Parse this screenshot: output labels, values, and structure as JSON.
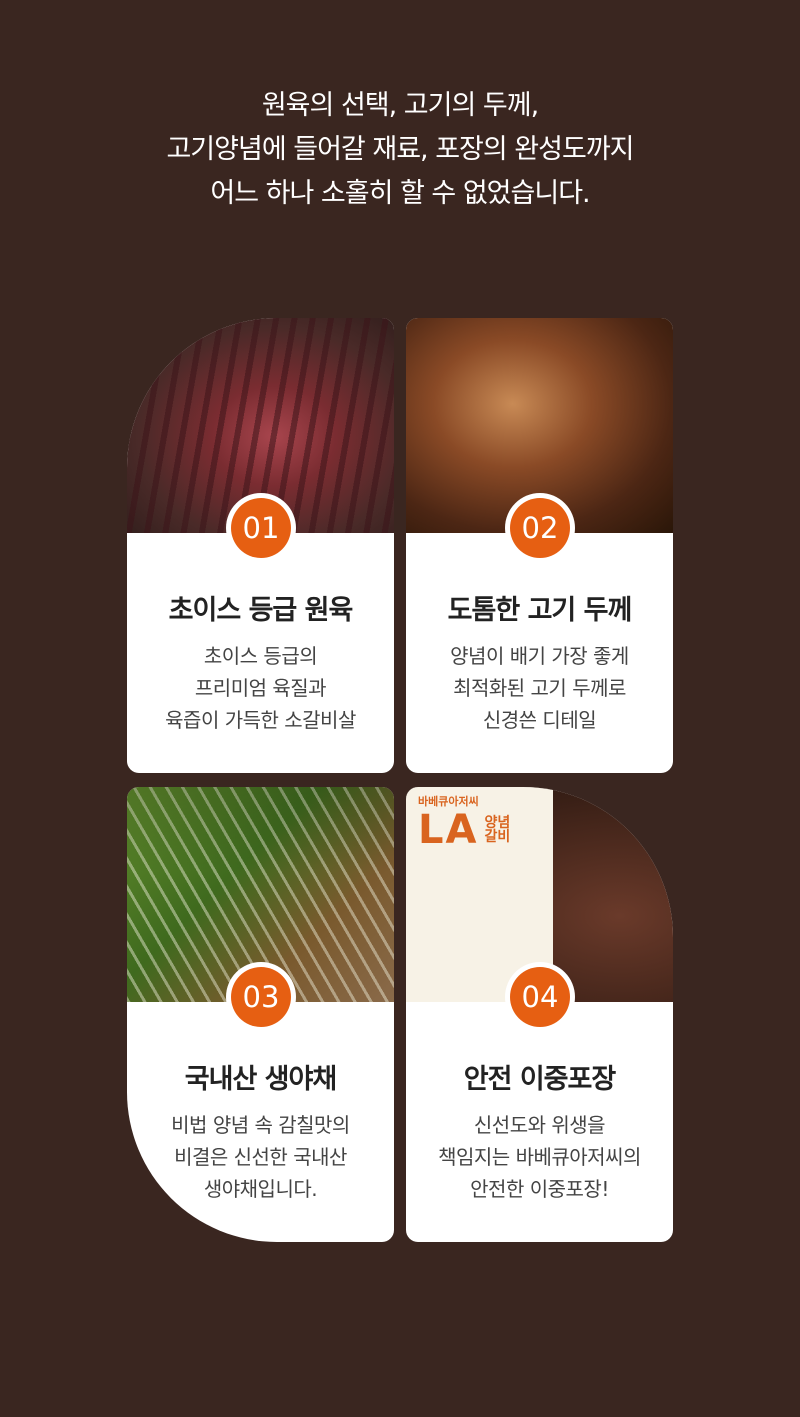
{
  "intro": {
    "lines": [
      "원육의 선택, 고기의 두께,",
      "고기양념에 들어갈 재료, 포장의 완성도까지",
      "어느 하나 소홀히 할 수 없었습니다."
    ]
  },
  "cards": [
    {
      "number": "01",
      "title": "초이스 등급 원육",
      "desc": [
        "초이스 등급의",
        "프리미엄 육질과",
        "육즙이 가득한 소갈비살"
      ]
    },
    {
      "number": "02",
      "title": "도톰한 고기 두께",
      "desc": [
        "양념이 배기 가장 좋게",
        "최적화된 고기 두께로",
        "신경쓴 디테일"
      ]
    },
    {
      "number": "03",
      "title": "국내산 생야채",
      "desc": [
        "비법 양념 속 감칠맛의",
        "비결은 신선한 국내산",
        "생야채입니다."
      ]
    },
    {
      "number": "04",
      "title": "안전 이중포장",
      "desc": [
        "신선도와 위생을",
        "책임지는 바베큐아저씨의",
        "안전한 이중포장!"
      ]
    }
  ],
  "package": {
    "brand": "바베큐아저씨",
    "la": "LA",
    "sub1": "양념",
    "sub2": "갈비"
  },
  "colors": {
    "background": "#3a2620",
    "accent": "#e65f12",
    "card": "#ffffff"
  }
}
